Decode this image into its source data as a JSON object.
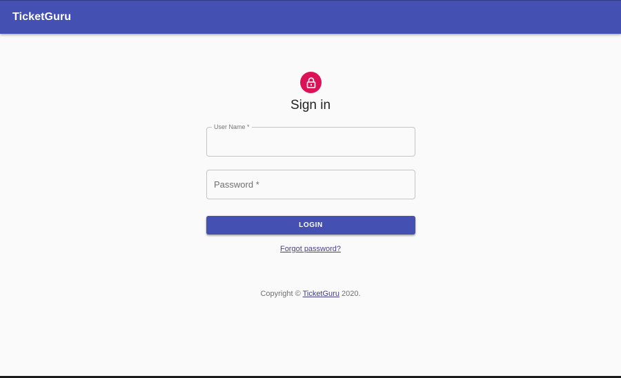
{
  "appbar": {
    "title": "TicketGuru",
    "color": "#4451b2"
  },
  "signin": {
    "icon": "lock-icon",
    "icon_color": "#dc1257",
    "title": "Sign in"
  },
  "form": {
    "username": {
      "label": "User Name *",
      "value": ""
    },
    "password": {
      "label": "Password *",
      "value": ""
    },
    "login_label": "LOGIN",
    "forgot_label": "Forgot password?"
  },
  "footer": {
    "prefix": "Copyright © ",
    "link": "TicketGuru",
    "suffix": " 2020."
  }
}
